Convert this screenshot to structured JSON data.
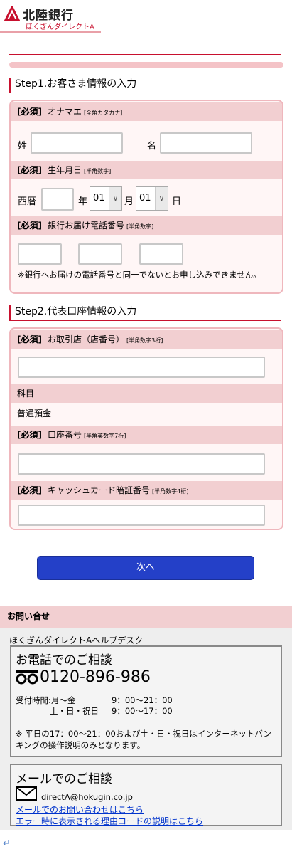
{
  "header": {
    "bank_name": "北陸銀行",
    "service_name": "ほくぎんダイレクトA"
  },
  "step1": {
    "title": "Step1.お客さま情報の入力",
    "name_row": {
      "required": "[必須]",
      "label": "オナマエ",
      "note": "[全角カタカナ]"
    },
    "sei_label": "姓",
    "mei_label": "名",
    "birth_row": {
      "required": "[必須]",
      "label": "生年月日",
      "note": "[半角数字]"
    },
    "era_label": "西暦",
    "year_label": "年",
    "month_value": "01",
    "month_label": "月",
    "day_value": "01",
    "day_label": "日",
    "phone_row": {
      "required": "[必須]",
      "label": "銀行お届け電話番号",
      "note": "[半角数字]"
    },
    "dash": "―",
    "phone_notice": "※銀行へお届けの電話番号と同一でないとお申し込みできません。"
  },
  "step2": {
    "title": "Step2.代表口座情報の入力",
    "branch_row": {
      "required": "[必須]",
      "label": "お取引店（店番号）",
      "note": "[半角数字3桁]"
    },
    "subject_label": "科目",
    "subject_value": "普通預金",
    "account_row": {
      "required": "[必須]",
      "label": "口座番号",
      "note": "[半角英数字7桁]"
    },
    "pin_row": {
      "required": "[必須]",
      "label": "キャッシュカード暗証番号",
      "note": "[半角数字4桁]"
    }
  },
  "next_button": "次へ",
  "contact": {
    "heading": "お問い合せ",
    "help_desk": "ほくぎんダイレクトAヘルプデスク",
    "phone_box": {
      "title": "お電話でのご相談",
      "number": "0120-896-986",
      "hours_label": "受付時間:",
      "weekday": "月～金",
      "weekday_hours": "9：00～21：00",
      "weekend": "土・日・祝日",
      "weekend_hours": "9：00～17：00",
      "note": "※ 平日の17：00～21：00および土・日・祝日はインターネットバンキングの操作説明のみとなります。"
    },
    "mail_box": {
      "title": "メールでのご相談",
      "email": "directA@hokugin.co.jp",
      "link_inquiry": "メールでのお問い合わせはこちら",
      "link_error": "エラー時に表示される理由コードの説明はこちら"
    }
  },
  "return_mark": "↵",
  "colors": {
    "accent": "#c8102e",
    "pink_header": "#f2cfd1",
    "button": "#2440c8"
  }
}
